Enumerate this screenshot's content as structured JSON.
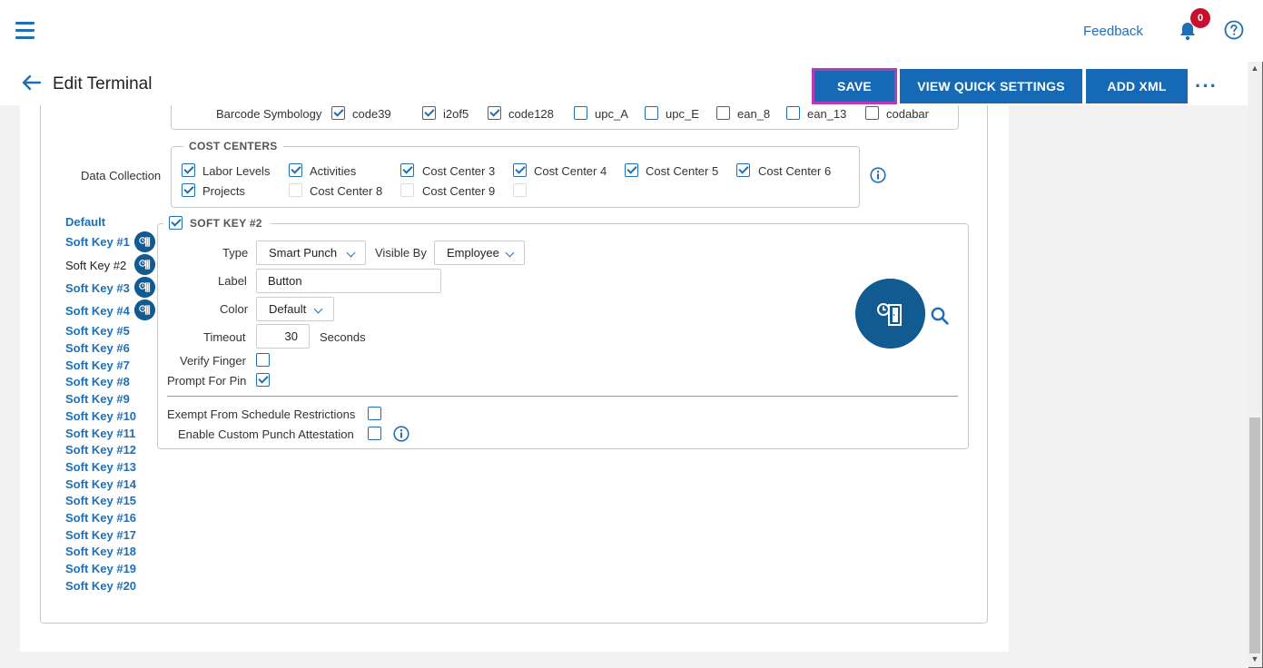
{
  "topbar": {
    "feedback": "Feedback",
    "notification_count": "0"
  },
  "header": {
    "title": "Edit Terminal",
    "save": "SAVE",
    "view_quick_settings": "VIEW QUICK SETTINGS",
    "add_xml": "ADD XML",
    "more": "···"
  },
  "barcode": {
    "label": "Barcode Symbology",
    "options": [
      {
        "label": "code39",
        "checked": true
      },
      {
        "label": "i2of5",
        "checked": true
      },
      {
        "label": "code128",
        "checked": true
      },
      {
        "label": "upc_A",
        "checked": false
      },
      {
        "label": "upc_E",
        "checked": false
      },
      {
        "label": "ean_8",
        "checked": false
      },
      {
        "label": "ean_13",
        "checked": false
      },
      {
        "label": "codabar",
        "checked": false
      }
    ]
  },
  "cost_centers": {
    "legend": "COST CENTERS",
    "row_label": "Data Collection",
    "items": [
      {
        "label": "Labor Levels",
        "checked": true
      },
      {
        "label": "Activities",
        "checked": true
      },
      {
        "label": "Cost Center 3",
        "checked": true
      },
      {
        "label": "Cost Center 4",
        "checked": true
      },
      {
        "label": "Cost Center 5",
        "checked": true
      },
      {
        "label": "Cost Center 6",
        "checked": true
      },
      {
        "label": "Projects",
        "checked": true
      },
      {
        "label": "Cost Center 8",
        "checked": false
      },
      {
        "label": "Cost Center 9",
        "checked": false
      }
    ]
  },
  "soft_keys": {
    "items": [
      "Default",
      "Soft Key #1",
      "Soft Key #2",
      "Soft Key #3",
      "Soft Key #4",
      "Soft Key #5",
      "Soft Key #6",
      "Soft Key #7",
      "Soft Key #8",
      "Soft Key #9",
      "Soft Key #10",
      "Soft Key #11",
      "Soft Key #12",
      "Soft Key #13",
      "Soft Key #14",
      "Soft Key #15",
      "Soft Key #16",
      "Soft Key #17",
      "Soft Key #18",
      "Soft Key #19",
      "Soft Key #20"
    ],
    "active": "Soft Key #2"
  },
  "soft_key_panel": {
    "legend": "SOFT KEY #2",
    "enabled": true,
    "type_label": "Type",
    "type_value": "Smart Punch",
    "visible_by_label": "Visible By",
    "visible_by_value": "Employee",
    "label_label": "Label",
    "label_value": "Button",
    "color_label": "Color",
    "color_value": "Default",
    "timeout_label": "Timeout",
    "timeout_value": "30",
    "timeout_unit": "Seconds",
    "verify_finger_label": "Verify Finger",
    "verify_finger": false,
    "prompt_pin_label": "Prompt For Pin",
    "prompt_pin": true,
    "exempt_label": "Exempt From Schedule Restrictions",
    "exempt": false,
    "attestation_label": "Enable Custom Punch Attestation",
    "attestation": false
  },
  "colors": {
    "primary": "#1569b5",
    "link": "#1f6fb6",
    "icon_bg": "#115a92",
    "badge": "#c8102e",
    "save_outline": "#b93ab6"
  }
}
